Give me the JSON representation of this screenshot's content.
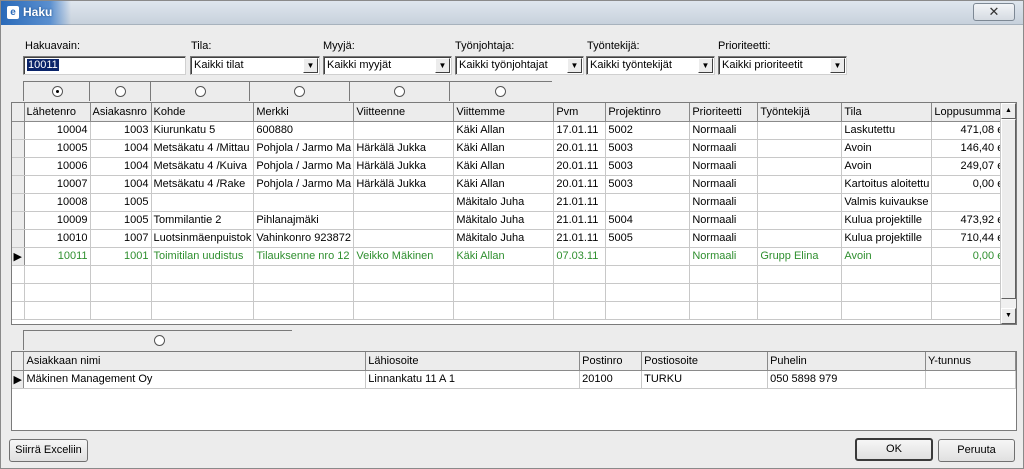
{
  "window": {
    "title": "Haku",
    "close_glyph": "✕"
  },
  "filters": {
    "hakuavain": {
      "label": "Hakuavain:",
      "value": "10011"
    },
    "tila": {
      "label": "Tila:",
      "value": "Kaikki tilat"
    },
    "myyja": {
      "label": "Myyjä:",
      "value": "Kaikki myyjät"
    },
    "tyonjohtaja": {
      "label": "Työnjohtaja:",
      "value": "Kaikki työnjohtajat"
    },
    "tyontekija": {
      "label": "Työntekijä:",
      "value": "Kaikki työntekijät"
    },
    "prioriteetti": {
      "label": "Prioriteetti:",
      "value": "Kaikki prioriteetit"
    }
  },
  "orders": {
    "sort_radios": [
      true,
      false,
      false,
      false,
      false,
      false
    ],
    "columns": [
      "Lähetenro",
      "Asiakasnro",
      "Kohde",
      "Merkki",
      "Viitteenne",
      "Viittemme",
      "Pvm",
      "Projektinro",
      "Prioriteetti",
      "Työntekijä",
      "Tila",
      "Loppusumma"
    ],
    "rows": [
      [
        "10004",
        "1003",
        "Kiurunkatu 5",
        "600880",
        "",
        "Käki Allan",
        "17.01.11",
        "5002",
        "Normaali",
        "",
        "Laskutettu",
        "471,08 e"
      ],
      [
        "10005",
        "1004",
        "Metsäkatu 4 /Mittau",
        "Pohjola / Jarmo Ma",
        "Härkälä Jukka",
        "Käki Allan",
        "20.01.11",
        "5003",
        "Normaali",
        "",
        "Avoin",
        "146,40 e"
      ],
      [
        "10006",
        "1004",
        "Metsäkatu 4 /Kuiva",
        "Pohjola / Jarmo Ma",
        "Härkälä Jukka",
        "Käki Allan",
        "20.01.11",
        "5003",
        "Normaali",
        "",
        "Avoin",
        "249,07 e"
      ],
      [
        "10007",
        "1004",
        "Metsäkatu 4 /Rake",
        "Pohjola / Jarmo Ma",
        "Härkälä Jukka",
        "Käki Allan",
        "20.01.11",
        "5003",
        "Normaali",
        "",
        "Kartoitus aloitettu",
        "0,00 e"
      ],
      [
        "10008",
        "1005",
        "",
        "",
        "",
        "Mäkitalo Juha",
        "21.01.11",
        "",
        "Normaali",
        "",
        "Valmis kuivaukse",
        ""
      ],
      [
        "10009",
        "1005",
        "Tommilantie 2",
        "Pihlanajmäki",
        "",
        "Mäkitalo Juha",
        "21.01.11",
        "5004",
        "Normaali",
        "",
        "Kulua projektille",
        "473,92 e"
      ],
      [
        "10010",
        "1007",
        "Luotsinmäenpuistok",
        "Vahinkonro 923872",
        "",
        "Mäkitalo Juha",
        "21.01.11",
        "5005",
        "Normaali",
        "",
        "Kulua projektille",
        "710,44 e"
      ],
      [
        "10011",
        "1001",
        "Toimitilan uudistus",
        "Tilauksenne nro 12",
        "Veikko Mäkinen",
        "Käki Allan",
        "07.03.11",
        "",
        "Normaali",
        "Grupp Elina",
        "Avoin",
        "0,00 e"
      ]
    ],
    "current_row_index": 7,
    "current_row_color": "#2f8f2f"
  },
  "customer": {
    "sort_radios": [
      false
    ],
    "columns": [
      "Asiakkaan nimi",
      "Lähiosoite",
      "Postinro",
      "Postiosoite",
      "Puhelin",
      "Y-tunnus"
    ],
    "rows": [
      [
        "Mäkinen Management Oy",
        "Linnankatu 11 A 1",
        "20100",
        "TURKU",
        "050 5898 979",
        ""
      ]
    ]
  },
  "buttons": {
    "excel": "Siirrä Exceliin",
    "ok": "OK",
    "cancel": "Peruuta"
  }
}
